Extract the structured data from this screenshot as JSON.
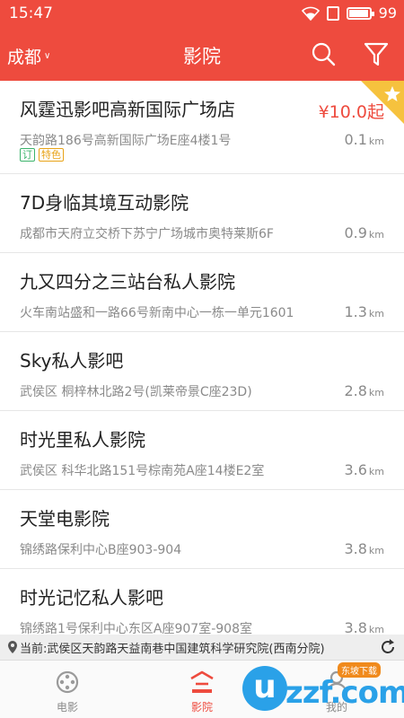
{
  "status_bar": {
    "time": "15:47",
    "battery": "99",
    "battery_level": 0.99
  },
  "app_bar": {
    "city": "成都",
    "title": "影院",
    "icons": [
      "search-icon",
      "filter-icon"
    ]
  },
  "colors": {
    "brand": "#ee4b3e",
    "tag_ding": "#3bb36b",
    "tag_tese": "#e8a317",
    "watermark": "#2aa1e8"
  },
  "cinemas": [
    {
      "name": "风霆迅影吧高新国际广场店",
      "address": "天韵路186号高新国际广场E座4楼1号",
      "distance": "0.1",
      "unit": "km",
      "price": "¥10.0起",
      "tags": [
        "订",
        "特色"
      ],
      "starred": true
    },
    {
      "name": "7D身临其境互动影院",
      "address": "成都市天府立交桥下苏宁广场城市奥特莱斯6F",
      "distance": "0.9",
      "unit": "km"
    },
    {
      "name": "九又四分之三站台私人影院",
      "address": "火车南站盛和一路66号新南中心一栋一单元1601",
      "distance": "1.3",
      "unit": "km"
    },
    {
      "name": "Sky私人影吧",
      "address": "武侯区 桐梓林北路2号(凯莱帝景C座23D)",
      "distance": "2.8",
      "unit": "km"
    },
    {
      "name": "时光里私人影院",
      "address": "武侯区 科华北路151号棕南苑A座14楼E2室",
      "distance": "3.6",
      "unit": "km"
    },
    {
      "name": "天堂电影院",
      "address": "锦绣路保利中心B座903-904",
      "distance": "3.8",
      "unit": "km"
    },
    {
      "name": "时光记忆私人影吧",
      "address": "锦绣路1号保利中心东区A座907室-908室",
      "distance": "3.8",
      "unit": "km"
    }
  ],
  "location_bar": {
    "text": "当前:武侯区天韵路天益南巷中国建筑科学研究院(西南分院)"
  },
  "tabs": [
    {
      "label": "电影",
      "icon": "film-icon",
      "active": false
    },
    {
      "label": "影院",
      "icon": "cinema-icon",
      "active": true
    },
    {
      "label": "我的",
      "icon": "profile-icon",
      "active": false
    }
  ],
  "watermark": {
    "logo_text": "uzzf.com",
    "badge": "东坡下载"
  }
}
